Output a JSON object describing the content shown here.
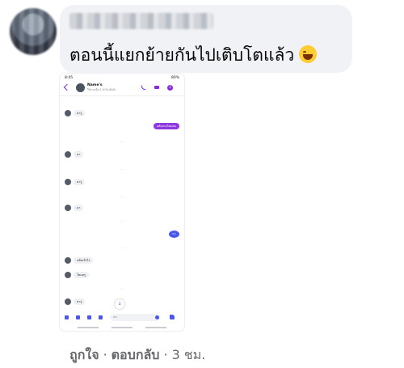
{
  "comment": {
    "text": "ตอนนี้แยกย้ายกันไปเติบโตแล้ว",
    "emoji_icon": "laughing-tears-emoji"
  },
  "screenshot": {
    "status_time": "8:45",
    "status_right": "80%",
    "contact_name": "Name's",
    "contact_sub": "ใช้งานเมื่อ 4 ชั่วโมงที่แล้ว",
    "messages": [
      {
        "dir": "in",
        "text": "มารู"
      },
      {
        "dir": "out",
        "text": "แต้นเกมโตแตม"
      },
      {
        "dir": "in",
        "text": "มา"
      },
      {
        "dir": "in",
        "text": "มารู"
      },
      {
        "dir": "in",
        "text": "มา"
      },
      {
        "dir": "out",
        "text": "มา"
      },
      {
        "dir": "in",
        "text": "แต้นเป้าไร"
      },
      {
        "dir": "in",
        "text": "โตแตรู"
      },
      {
        "dir": "in",
        "text": "มารู"
      }
    ],
    "input_placeholder": "Aa"
  },
  "actions": {
    "like": "ถูกใจ",
    "separator": "·",
    "reply": "ตอบกลับ",
    "time": "3 ชม."
  },
  "colors": {
    "bubble_bg": "#f0f2f5",
    "messenger_purple": "#8e38e0",
    "messenger_blue": "#4a57e8",
    "action_text": "#65676b"
  }
}
